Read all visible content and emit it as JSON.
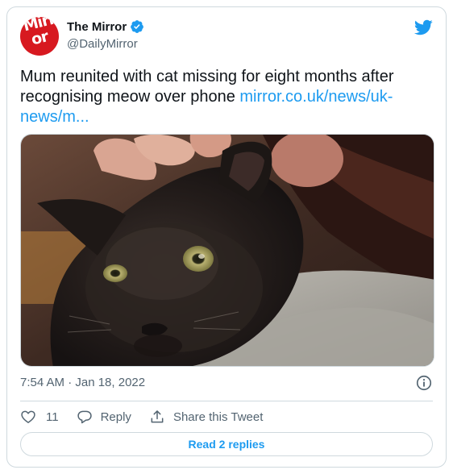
{
  "author": {
    "avatar_text": "Mirror",
    "display_name": "The Mirror",
    "handle": "@DailyMirror",
    "verified": true
  },
  "tweet": {
    "text": "Mum reunited with cat missing for eight months after recognising meow over phone",
    "link": "mirror.co.uk/news/uk-news/m..."
  },
  "media": {
    "subject": "black cat held on a shoulder"
  },
  "timestamp": "7:54 AM · Jan 18, 2022",
  "actions": {
    "like_count": "11",
    "reply_label": "Reply",
    "share_label": "Share this Tweet"
  },
  "read_replies_label": "Read 2 replies",
  "colors": {
    "accent": "#1d9bf0",
    "brand_red": "#d71920",
    "muted_text": "#536471",
    "border": "#cfd9de"
  },
  "icons": [
    "verified-badge-icon",
    "twitter-bird-icon",
    "info-icon",
    "heart-icon",
    "reply-bubble-icon",
    "share-icon"
  ]
}
